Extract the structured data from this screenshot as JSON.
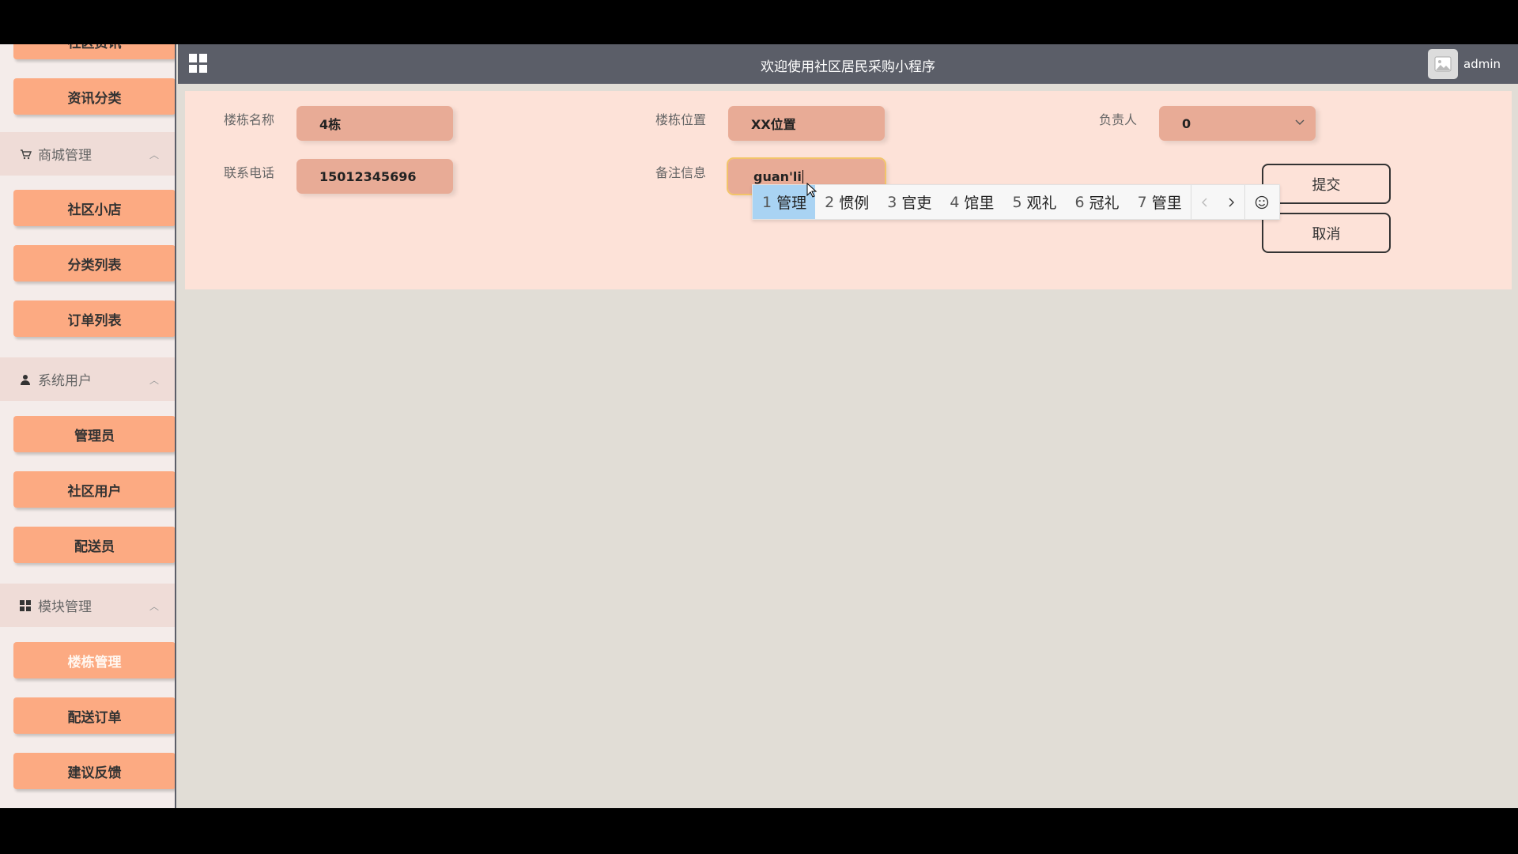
{
  "header": {
    "title": "欢迎使用社区居民采购小程序",
    "username": "admin"
  },
  "sidebar": {
    "top_partial_label": "社区资讯",
    "info_category": "资讯分类",
    "groups": {
      "mall": {
        "label": "商城管理",
        "icon": "cart-icon",
        "items": [
          "社区小店",
          "分类列表",
          "订单列表"
        ]
      },
      "users": {
        "label": "系统用户",
        "icon": "person-icon",
        "items": [
          "管理员",
          "社区用户",
          "配送员"
        ]
      },
      "modules": {
        "label": "模块管理",
        "icon": "grid-icon",
        "items": [
          "楼栋管理",
          "配送订单",
          "建议反馈"
        ],
        "active": "楼栋管理"
      }
    }
  },
  "form": {
    "building_name": {
      "label": "楼栋名称",
      "value": "4栋"
    },
    "building_location": {
      "label": "楼栋位置",
      "value": "XX位置"
    },
    "manager": {
      "label": "负责人",
      "value": "0"
    },
    "phone": {
      "label": "联系电话",
      "value": "15012345696"
    },
    "remark": {
      "label": "备注信息",
      "value": "guan'li"
    },
    "submit_label": "提交",
    "cancel_label": "取消"
  },
  "ime": {
    "candidates": [
      {
        "num": "1",
        "text": "管理"
      },
      {
        "num": "2",
        "text": "惯例"
      },
      {
        "num": "3",
        "text": "官吏"
      },
      {
        "num": "4",
        "text": "馆里"
      },
      {
        "num": "5",
        "text": "观礼"
      },
      {
        "num": "6",
        "text": "冠礼"
      },
      {
        "num": "7",
        "text": "管里"
      }
    ],
    "selected_index": 0,
    "prev_icon": "chevron-left-icon",
    "next_icon": "chevron-right-icon",
    "emoji_icon": "smiley-icon"
  },
  "colors": {
    "sidebar_button": "#fcaa82",
    "header": "#5b5e68",
    "panel": "#fde2d8",
    "field": "#e8ab96",
    "ime_selected": "#a9d3f3"
  }
}
